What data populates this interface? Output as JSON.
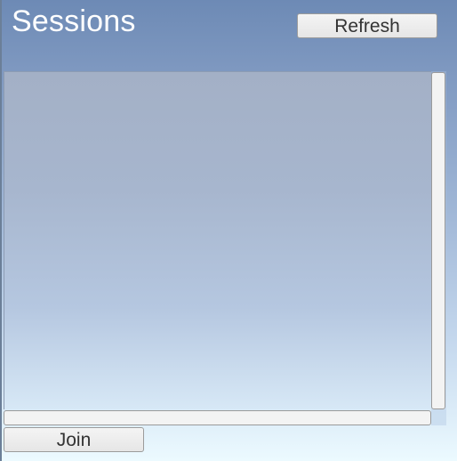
{
  "header": {
    "title": "Sessions",
    "refresh_label": "Refresh"
  },
  "sessions_list": {
    "items": []
  },
  "footer": {
    "join_label": "Join"
  }
}
